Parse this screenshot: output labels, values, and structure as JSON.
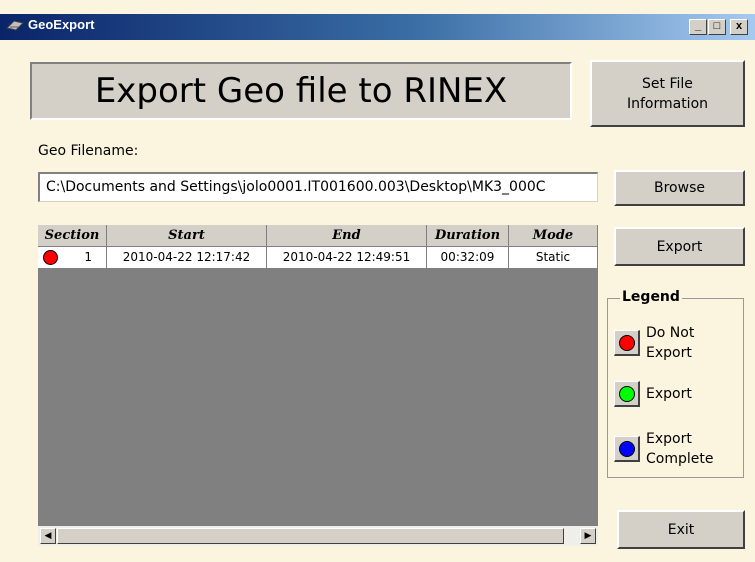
{
  "window": {
    "title": "GeoExport",
    "minimize_glyph": "_",
    "maximize_glyph": "□",
    "close_glyph": "x"
  },
  "heading": "Export Geo file to RINEX",
  "buttons": {
    "set_file_information": "Set File\nInformation",
    "browse": "Browse",
    "export": "Export",
    "exit": "Exit"
  },
  "filename": {
    "label": "Geo Filename:",
    "value": "C:\\Documents and Settings\\jolo0001.IT001600.003\\Desktop\\MK3_000C"
  },
  "table": {
    "columns": [
      "Section",
      "Start",
      "End",
      "Duration",
      "Mode"
    ],
    "rows": [
      {
        "section": "1",
        "status_color": "#ff0000",
        "start": "2010-04-22 12:17:42",
        "end": "2010-04-22 12:49:51",
        "duration": "00:32:09",
        "mode": "Static"
      }
    ]
  },
  "scrollbar": {
    "left_icon": "arrow-left-icon",
    "right_icon": "arrow-right-icon"
  },
  "legend": {
    "title": "Legend",
    "items": [
      {
        "label": "Do Not\nExport",
        "color": "#ff0000",
        "icon": "red-circle-icon"
      },
      {
        "label": "Export",
        "color": "#00ff00",
        "icon": "green-circle-icon"
      },
      {
        "label": "Export\nComplete",
        "color": "#0000ff",
        "icon": "blue-circle-icon"
      }
    ]
  }
}
